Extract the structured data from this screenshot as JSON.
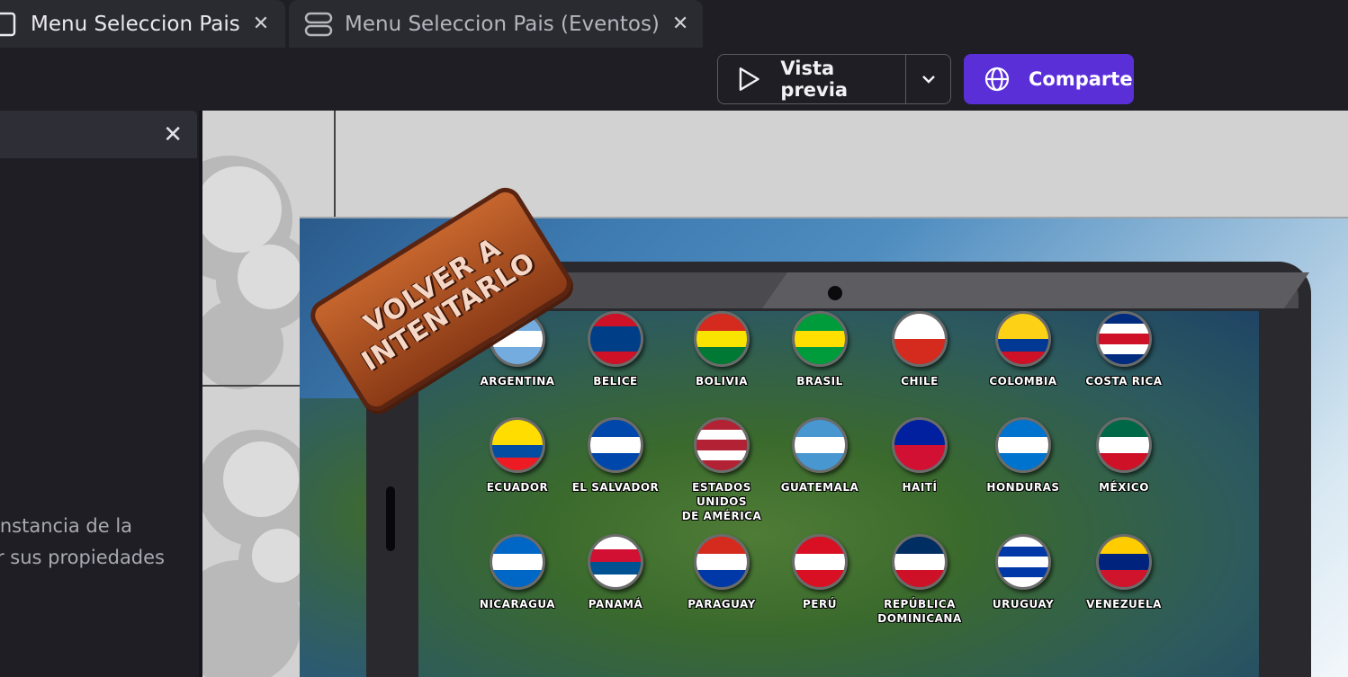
{
  "tabs": [
    {
      "label": "Menu Seleccion Pais",
      "icon": "film-icon",
      "active": true
    },
    {
      "label": "Menu Seleccion Pais (Eventos)",
      "icon": "database-icon",
      "active": false
    }
  ],
  "toolbar": {
    "preview_label": "Vista previa",
    "share_label": "Comparte"
  },
  "left_panel": {
    "text_line1": "instancia de la",
    "text_line2": "r sus propiedades"
  },
  "canvas": {
    "badge_line1": "VOLVER A",
    "badge_line2": "INTENTARLO",
    "countries": [
      {
        "name": "ARGENTINA",
        "colors": [
          "#74acdf",
          "#ffffff",
          "#74acdf"
        ]
      },
      {
        "name": "BELICE",
        "colors": [
          "#ce1126",
          "#003f87",
          "#003f87",
          "#ce1126"
        ]
      },
      {
        "name": "BOLIVIA",
        "colors": [
          "#d52b1e",
          "#f9e300",
          "#007934"
        ]
      },
      {
        "name": "BRASIL",
        "colors": [
          "#009c3b",
          "#ffdf00",
          "#009c3b"
        ]
      },
      {
        "name": "CHILE",
        "colors": [
          "#ffffff",
          "#d52b1e"
        ]
      },
      {
        "name": "COLOMBIA",
        "colors": [
          "#fcd116",
          "#fcd116",
          "#003893",
          "#ce1126"
        ]
      },
      {
        "name": "COSTA RICA",
        "colors": [
          "#002b7f",
          "#ffffff",
          "#ce1126",
          "#ffffff",
          "#002b7f"
        ]
      },
      {
        "name": "ECUADOR",
        "colors": [
          "#ffdd00",
          "#ffdd00",
          "#034ea2",
          "#ed1c24"
        ]
      },
      {
        "name": "EL SALVADOR",
        "colors": [
          "#0047ab",
          "#ffffff",
          "#0047ab"
        ]
      },
      {
        "name": "ESTADOS UNIDOS DE AMÉRICA",
        "colors": [
          "#b22234",
          "#ffffff",
          "#b22234",
          "#ffffff",
          "#b22234"
        ]
      },
      {
        "name": "GUATEMALA",
        "colors": [
          "#4997d0",
          "#ffffff",
          "#4997d0"
        ]
      },
      {
        "name": "HAITÍ",
        "colors": [
          "#00209f",
          "#d21034"
        ]
      },
      {
        "name": "HONDURAS",
        "colors": [
          "#0073cf",
          "#ffffff",
          "#0073cf"
        ]
      },
      {
        "name": "MÉXICO",
        "colors": [
          "#006847",
          "#ffffff",
          "#ce1126"
        ]
      },
      {
        "name": "NICARAGUA",
        "colors": [
          "#0067c6",
          "#ffffff",
          "#0067c6"
        ]
      },
      {
        "name": "PANAMÁ",
        "colors": [
          "#ffffff",
          "#d21034",
          "#005293",
          "#ffffff"
        ]
      },
      {
        "name": "PARAGUAY",
        "colors": [
          "#d52b1e",
          "#ffffff",
          "#0038a8"
        ]
      },
      {
        "name": "PERÚ",
        "colors": [
          "#d91023",
          "#ffffff",
          "#d91023"
        ]
      },
      {
        "name": "REPÚBLICA DOMINICANA",
        "colors": [
          "#002d62",
          "#ffffff",
          "#ce1126"
        ]
      },
      {
        "name": "URUGUAY",
        "colors": [
          "#ffffff",
          "#0038a8",
          "#ffffff",
          "#0038a8",
          "#ffffff"
        ]
      },
      {
        "name": "VENEZUELA",
        "colors": [
          "#ffcc00",
          "#00247d",
          "#cf142b"
        ]
      }
    ]
  }
}
